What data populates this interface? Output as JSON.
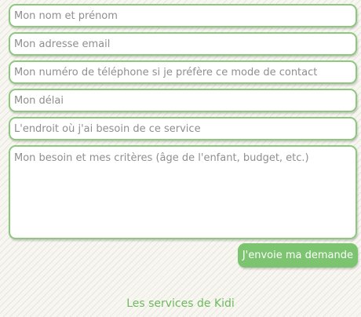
{
  "form": {
    "fields": [
      {
        "placeholder": "Mon nom et prénom"
      },
      {
        "placeholder": "Mon adresse email"
      },
      {
        "placeholder": "Mon numéro de téléphone si je préfère ce mode de contact"
      },
      {
        "placeholder": "Mon délai"
      },
      {
        "placeholder": "L'endroit où j'ai besoin de ce service"
      }
    ],
    "message_placeholder": "Mon besoin et mes critères (âge de l'enfant, budget, etc.)",
    "submit_label": "J'envoie ma demande"
  },
  "footer": {
    "title": "Les services de Kidi"
  },
  "colors": {
    "accent": "#7cc470",
    "border": "#8cc97e",
    "footer_text": "#6dbb5e"
  }
}
